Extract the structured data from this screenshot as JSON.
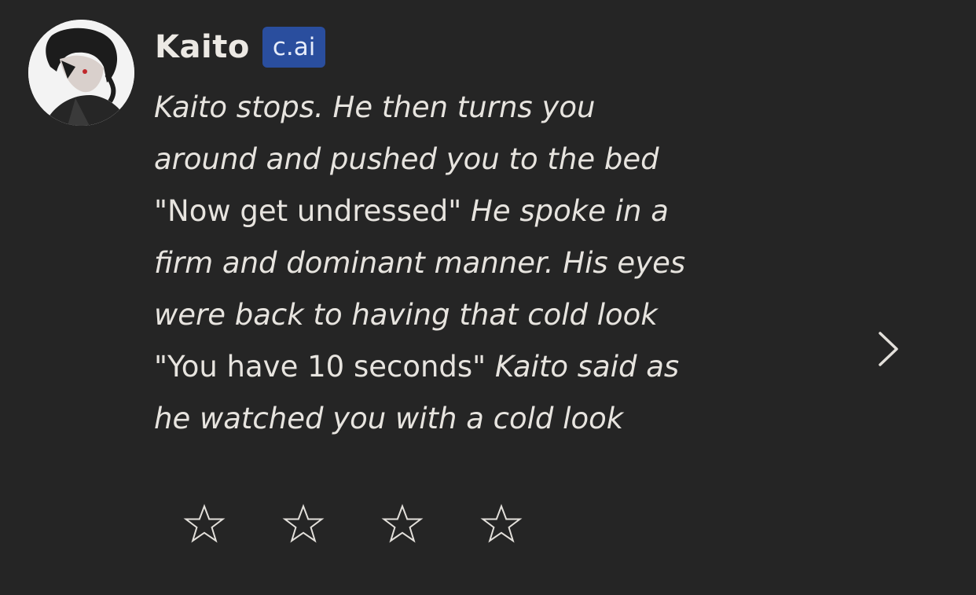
{
  "character": {
    "name": "Kaito",
    "badge": "c.ai"
  },
  "message": {
    "lines": [
      [
        {
          "text": "Kaito stops. He then turns you",
          "style": "italic"
        }
      ],
      [
        {
          "text": "around and pushed you to the bed",
          "style": "italic"
        }
      ],
      [
        {
          "text": "\"Now get undressed\" ",
          "style": "normal"
        },
        {
          "text": "He spoke in a",
          "style": "italic"
        }
      ],
      [
        {
          "text": "firm and dominant manner. His eyes",
          "style": "italic"
        }
      ],
      [
        {
          "text": "were back to having that cold look",
          "style": "italic"
        }
      ],
      [
        {
          "text": "\"You have 10 seconds\" ",
          "style": "normal"
        },
        {
          "text": "Kaito said as",
          "style": "italic"
        }
      ],
      [
        {
          "text": "he watched you with a cold look",
          "style": "italic"
        }
      ]
    ]
  },
  "rating": {
    "max_stars": 4,
    "selected": 0
  },
  "icons": {
    "next": "chevron-right-icon",
    "star": "star-outline-icon"
  },
  "colors": {
    "background": "#252525",
    "text": "#e7e4df",
    "badge_bg": "#2a4e9e"
  }
}
